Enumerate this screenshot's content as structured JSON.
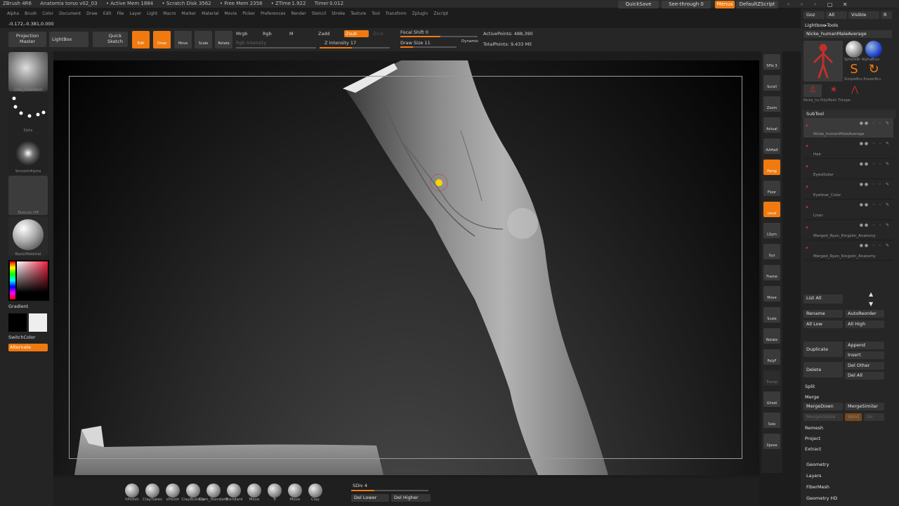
{
  "title_bar": {
    "app": "ZBrush 4R6",
    "file": "Anatomia torso v02_03",
    "stats": [
      "• Active Mem 1884",
      "• Scratch Disk 3562",
      "• Free Mem 2358",
      "• ZTime 1.922",
      "Timer 0.012"
    ]
  },
  "menu_items": [
    "Alpha",
    "Brush",
    "Color",
    "Document",
    "Draw",
    "Edit",
    "File",
    "Layer",
    "Light",
    "Macro",
    "Marker",
    "Material",
    "Movie",
    "Picker",
    "Preferences",
    "Render",
    "Stencil",
    "Stroke",
    "Texture",
    "Tool",
    "Transform",
    "Zplugin",
    "Zscript"
  ],
  "top_right": {
    "quicksave": "QuickSave",
    "seethrough": "See-through 0",
    "menus": "Menus",
    "script": "DefaultZScript"
  },
  "coords": "-0.172,-0.381,0.000",
  "toolbar": {
    "projection_master": "Projection Master",
    "lightbox": "LightBox",
    "quick_sketch": "Quick Sketch",
    "edit": "Edit",
    "draw": "Draw",
    "move": "Move",
    "scale": "Scale",
    "rotate": "Rotate",
    "mrgb": "Mrgb",
    "rgb": "Rgb",
    "m": "M",
    "rgb_intensity": "Rgb Intensity",
    "zadd": "Zadd",
    "zsub": "Zsub",
    "zcut": "Zcut",
    "z_intensity": "Z Intensity 17",
    "focal_shift": "Focal Shift 0",
    "draw_size": "Draw Size 11",
    "dynamic": "Dynamic",
    "active_points": "ActivePoints: 488,390",
    "total_points": "TotalPoints: 9.433 Mil"
  },
  "left_panel": {
    "brush_label": "Clay_Standard",
    "stroke_label": "Dots",
    "alpha_label": "SmoothAlpha",
    "texture_label": "Texture Off",
    "material_label": "BasicMaterial",
    "gradient": "Gradient",
    "switch_color": "SwitchColor",
    "alternate": "Alternate"
  },
  "right_shelf": [
    "SPix 3",
    "Scroll",
    "Zoom",
    "Actual",
    "AAHalf",
    "Persp",
    "Floor",
    "Local",
    "LSym",
    "Xyz",
    "Frame",
    "Move",
    "Scale",
    "Rotate",
    "PolyF",
    "Transp",
    "Ghost",
    "Solo",
    "Xpose"
  ],
  "right_panel": {
    "tabs": [
      "Goz",
      "All",
      "Visible",
      "R"
    ],
    "lightbox_tools": "Lightbox▸Tools",
    "current_tool": "Nicke_humanMaleAverage",
    "tool_thumbs": [
      "SphereBr",
      "AlphaBrus",
      "SimpleBru",
      "EraserBru",
      "Nicke_hu",
      "PolyMesh",
      "Tricepe"
    ],
    "subtool_header": "SubTool",
    "subtools": [
      "Nicke_humanMaleAverage",
      "Hair",
      "EyesOuter",
      "Eyeliner_Color",
      "Liner",
      "Merged_Ryan_Kingslin_Anatomy",
      "Merged_Ryan_Kingslin_Anatomy"
    ],
    "buttons": {
      "list_all": "List All",
      "rename": "Rename",
      "autoreorder": "AutoReorder",
      "all_low": "All Low",
      "all_high": "All High",
      "duplicate": "Duplicate",
      "append": "Append",
      "insert": "Insert",
      "delete": "Delete",
      "del_other": "Del Other",
      "del_all": "Del All",
      "split": "Split",
      "merge": "Merge",
      "merge_down": "MergeDown",
      "merge_similar": "MergeSimilar",
      "merge_visible": "MergeVisible",
      "weld": "Weld",
      "uv": "Uv",
      "remesh": "Remesh",
      "project": "Project",
      "extract": "Extract"
    },
    "sections": [
      "Geometry",
      "Layers",
      "FiberMesh",
      "Geometry HD"
    ]
  },
  "bottom": {
    "brushes": [
      "hPolish",
      "ClayTubes",
      "sPolish",
      "ClayBuildUp",
      "Dam_Standard",
      "Standard",
      "Move",
      "Tr",
      "Move",
      "Clay"
    ],
    "sdiv": "SDiv 4",
    "del_lower": "Del Lower",
    "del_higher": "Del Higher"
  }
}
